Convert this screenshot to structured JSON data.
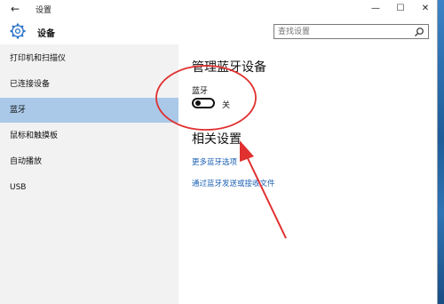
{
  "window": {
    "title": "设置",
    "back_glyph": "←",
    "min_glyph": "—",
    "max_glyph": "☐",
    "close_glyph": "✕"
  },
  "header": {
    "title": "设备",
    "search_placeholder": "查找设置"
  },
  "sidebar": {
    "items": [
      {
        "label": "打印机和扫描仪",
        "selected": false
      },
      {
        "label": "已连接设备",
        "selected": false
      },
      {
        "label": "蓝牙",
        "selected": true
      },
      {
        "label": "鼠标和触摸板",
        "selected": false
      },
      {
        "label": "自动播放",
        "selected": false
      },
      {
        "label": "USB",
        "selected": false
      }
    ]
  },
  "main": {
    "heading": "管理蓝牙设备",
    "bluetooth_label": "蓝牙",
    "toggle_state": "关",
    "toggle_on": false,
    "related_heading": "相关设置",
    "links": [
      "更多蓝牙选项",
      "通过蓝牙发送或接收文件"
    ]
  },
  "colors": {
    "accent": "#2b73c6",
    "selected_bg": "#aac9e9",
    "link": "#1a5fb4",
    "annotation": "#e0302f"
  }
}
